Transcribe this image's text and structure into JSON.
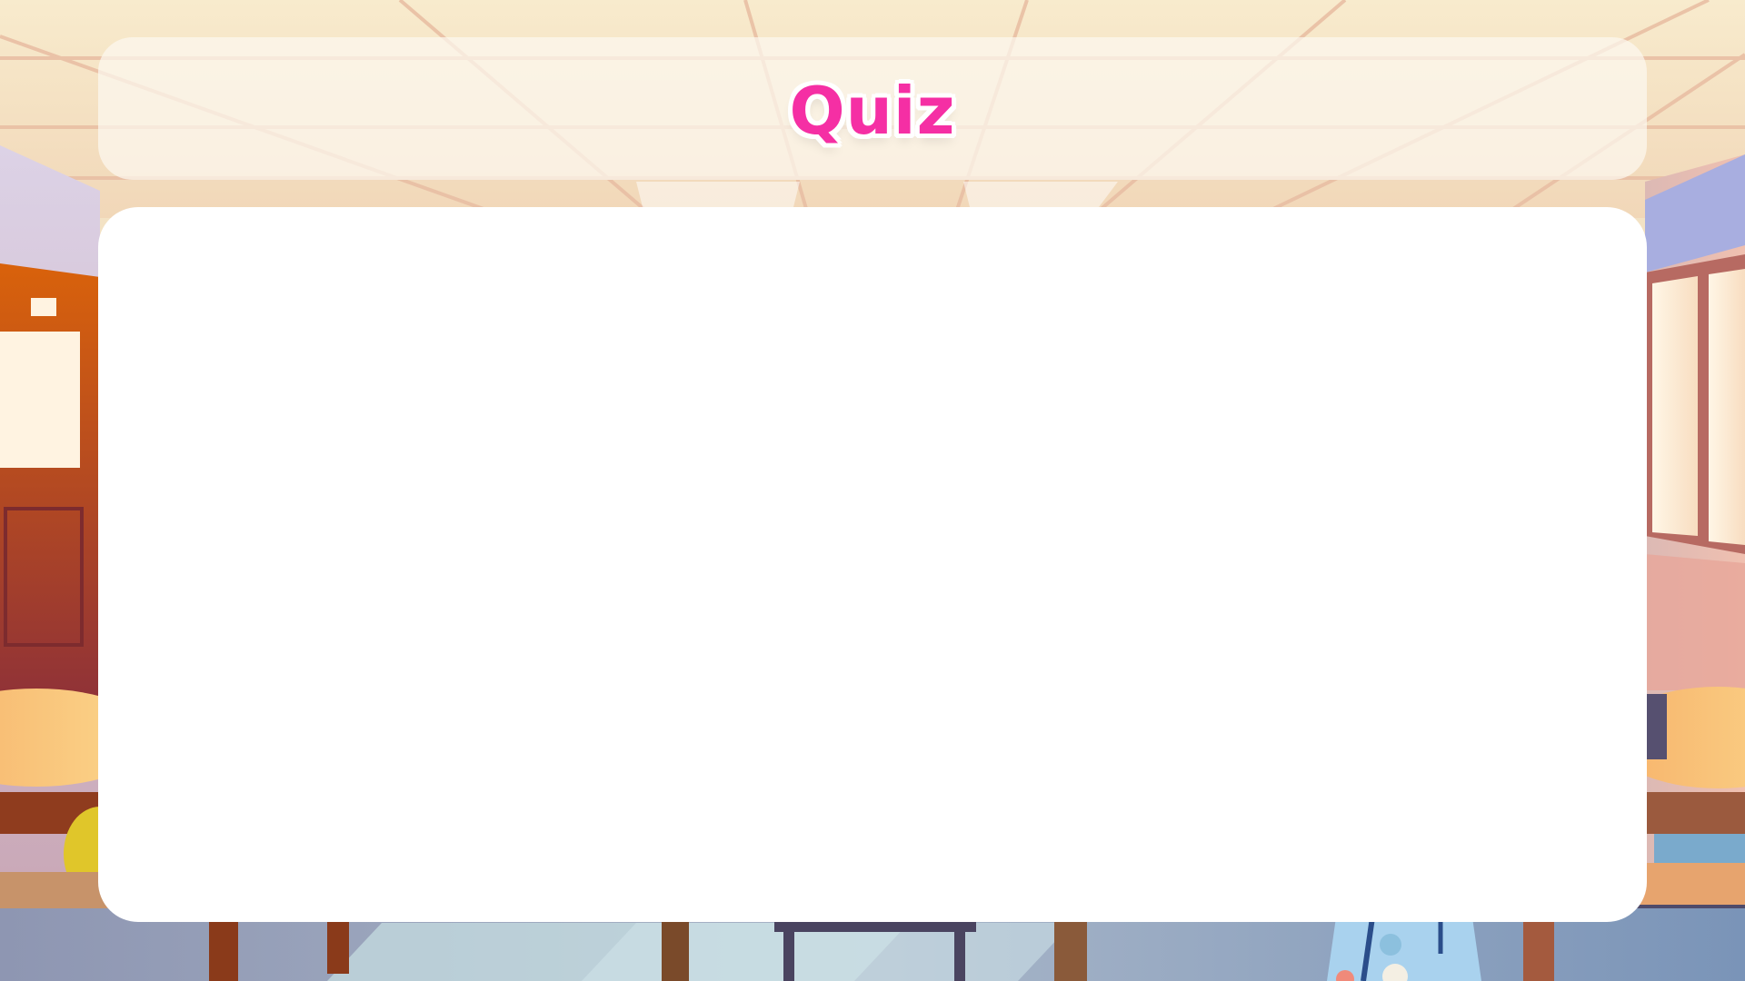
{
  "title": {
    "text": "Quiz"
  },
  "icons": {
    "background": "classroom-background-illustration"
  },
  "colors": {
    "title_text": "#f52fa4",
    "title_outline": "#ffffff",
    "card_background": "#ffffff",
    "banner_background": "#fcf8f0"
  }
}
